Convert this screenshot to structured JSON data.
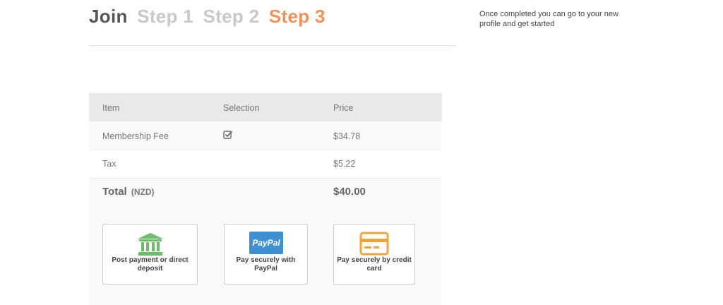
{
  "header": {
    "join": "Join",
    "step1": "Step 1",
    "step2": "Step 2",
    "step3": "Step 3"
  },
  "side_note": "Once completed you can go to your new profile and get started",
  "table": {
    "columns": [
      "Item",
      "Selection",
      "Price"
    ],
    "rows": [
      {
        "item": "Membership Fee",
        "selected": true,
        "price": "$34.78"
      },
      {
        "item": "Tax",
        "price": "$5.22"
      }
    ],
    "total": {
      "label": "Total",
      "currency": "(NZD)",
      "price": "$40.00"
    }
  },
  "payment_options": [
    {
      "label": "Post payment or direct deposit",
      "icon": "bank-icon",
      "color": "#6cbf6a"
    },
    {
      "label": "Pay securely with PayPal",
      "icon": "paypal-icon",
      "badge": "PayPal",
      "color": "#3f8fd3"
    },
    {
      "label": "Pay securely by credit card",
      "icon": "credit-card-icon",
      "color": "#eda43b"
    }
  ],
  "colors": {
    "active_step": "#f0925a",
    "inactive_step": "#c9c9c9"
  }
}
